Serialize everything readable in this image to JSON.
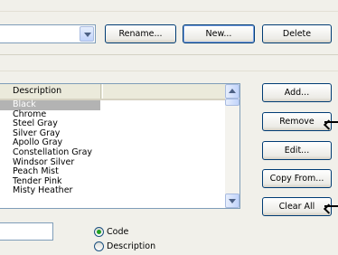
{
  "top_bar": {
    "combo_value": "",
    "rename_label": "Rename...",
    "new_label": "New...",
    "delete_label": "Delete"
  },
  "list": {
    "columns": [
      "Description",
      ""
    ],
    "items": [
      "Black",
      "Chrome",
      "Steel Gray",
      "Silver Gray",
      "Apollo Gray",
      "Constellation Gray",
      "Windsor Silver",
      "Peach Mist",
      "Tender Pink",
      "Misty Heather"
    ],
    "selected_index": 0
  },
  "side_buttons": {
    "add": "Add...",
    "remove": "Remove",
    "edit": "Edit...",
    "copy_from": "Copy From...",
    "clear_all": "Clear All"
  },
  "sort": {
    "options": [
      "Code",
      "Description"
    ],
    "selected": "Code"
  },
  "colors": {
    "selection": "#b3b3b3",
    "window_bg": "#f1f0ea",
    "button_border": "#003c74",
    "radio_dot": "#21a121"
  }
}
